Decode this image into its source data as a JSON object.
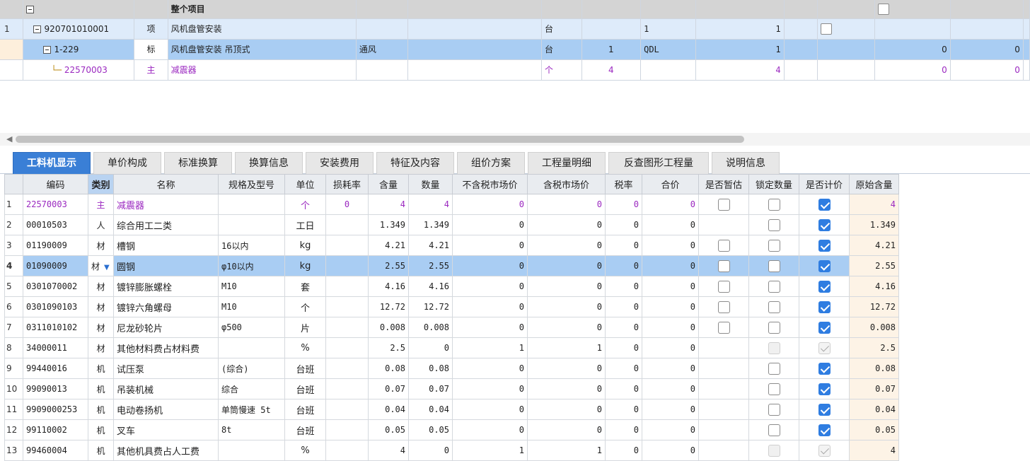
{
  "top_grid": {
    "header": {
      "title": "整个项目"
    },
    "rows": [
      {
        "no": "1",
        "code": "920701010001",
        "type": "项",
        "name": "风机盘管安装",
        "spec": "",
        "unit": "台",
        "qty1": "",
        "expr": "1",
        "qty": "1",
        "v1": "",
        "v2": ""
      },
      {
        "no": "",
        "code": "1-229",
        "type": "标",
        "name": "风机盘管安装 吊顶式",
        "spec": "通风",
        "unit": "台",
        "qty1": "1",
        "expr": "QDL",
        "qty": "1",
        "v1": "0",
        "v2": "0"
      },
      {
        "no": "",
        "code": "22570003",
        "type": "主",
        "name": "减震器",
        "spec": "",
        "unit": "个",
        "qty1": "4",
        "expr": "",
        "qty": "4",
        "v1": "0",
        "v2": "0"
      }
    ]
  },
  "tabs": [
    "工料机显示",
    "单价构成",
    "标准换算",
    "换算信息",
    "安装费用",
    "特征及内容",
    "组价方案",
    "工程量明细",
    "反查图形工程量",
    "说明信息"
  ],
  "active_tab": "工料机显示",
  "detail_grid": {
    "columns": [
      "",
      "编码",
      "类别",
      "名称",
      "规格及型号",
      "单位",
      "损耗率",
      "含量",
      "数量",
      "不含税市场价",
      "含税市场价",
      "税率",
      "合价",
      "是否暂估",
      "锁定数量",
      "是否计价",
      "原始含量"
    ],
    "rows": [
      {
        "idx": "1",
        "code": "22570003",
        "cat": "主",
        "name": "减震器",
        "spec": "",
        "unit": "个",
        "loss": "0",
        "content": "4",
        "qty": "4",
        "price_ex": "0",
        "price_in": "0",
        "tax": "0",
        "total": "0",
        "est": "off",
        "lock": "off",
        "priced": "on",
        "orig": "4"
      },
      {
        "idx": "2",
        "code": "00010503",
        "cat": "人",
        "name": "综合用工二类",
        "spec": "",
        "unit": "工日",
        "loss": "",
        "content": "1.349",
        "qty": "1.349",
        "price_ex": "0",
        "price_in": "0",
        "tax": "0",
        "total": "0",
        "est": "none",
        "lock": "off",
        "priced": "on",
        "orig": "1.349"
      },
      {
        "idx": "3",
        "code": "01190009",
        "cat": "材",
        "name": "槽钢",
        "spec": "16以内",
        "unit": "kg",
        "loss": "",
        "content": "4.21",
        "qty": "4.21",
        "price_ex": "0",
        "price_in": "0",
        "tax": "0",
        "total": "0",
        "est": "off",
        "lock": "off",
        "priced": "on",
        "orig": "4.21"
      },
      {
        "idx": "4",
        "code": "01090009",
        "cat": "材",
        "name": "圆钢",
        "spec": "φ10以内",
        "unit": "kg",
        "loss": "",
        "content": "2.55",
        "qty": "2.55",
        "price_ex": "0",
        "price_in": "0",
        "tax": "0",
        "total": "0",
        "est": "off",
        "lock": "off",
        "priced": "on",
        "orig": "2.55"
      },
      {
        "idx": "5",
        "code": "0301070002",
        "cat": "材",
        "name": "镀锌膨胀螺栓",
        "spec": "M10",
        "unit": "套",
        "loss": "",
        "content": "4.16",
        "qty": "4.16",
        "price_ex": "0",
        "price_in": "0",
        "tax": "0",
        "total": "0",
        "est": "off",
        "lock": "off",
        "priced": "on",
        "orig": "4.16"
      },
      {
        "idx": "6",
        "code": "0301090103",
        "cat": "材",
        "name": "镀锌六角螺母",
        "spec": "M10",
        "unit": "个",
        "loss": "",
        "content": "12.72",
        "qty": "12.72",
        "price_ex": "0",
        "price_in": "0",
        "tax": "0",
        "total": "0",
        "est": "off",
        "lock": "off",
        "priced": "on",
        "orig": "12.72"
      },
      {
        "idx": "7",
        "code": "0311010102",
        "cat": "材",
        "name": "尼龙砂轮片",
        "spec": "φ500",
        "unit": "片",
        "loss": "",
        "content": "0.008",
        "qty": "0.008",
        "price_ex": "0",
        "price_in": "0",
        "tax": "0",
        "total": "0",
        "est": "off",
        "lock": "off",
        "priced": "on",
        "orig": "0.008"
      },
      {
        "idx": "8",
        "code": "34000011",
        "cat": "材",
        "name": "其他材料费占材料费",
        "spec": "",
        "unit": "%",
        "loss": "",
        "content": "2.5",
        "qty": "0",
        "price_ex": "1",
        "price_in": "1",
        "tax": "0",
        "total": "0",
        "est": "none",
        "lock": "disabled",
        "priced": "disabled-on",
        "orig": "2.5"
      },
      {
        "idx": "9",
        "code": "99440016",
        "cat": "机",
        "name": "试压泵",
        "spec": "(综合)",
        "unit": "台班",
        "loss": "",
        "content": "0.08",
        "qty": "0.08",
        "price_ex": "0",
        "price_in": "0",
        "tax": "0",
        "total": "0",
        "est": "none",
        "lock": "off",
        "priced": "on",
        "orig": "0.08"
      },
      {
        "idx": "10",
        "code": "99090013",
        "cat": "机",
        "name": "吊装机械",
        "spec": "综合",
        "unit": "台班",
        "loss": "",
        "content": "0.07",
        "qty": "0.07",
        "price_ex": "0",
        "price_in": "0",
        "tax": "0",
        "total": "0",
        "est": "none",
        "lock": "off",
        "priced": "on",
        "orig": "0.07"
      },
      {
        "idx": "11",
        "code": "9909000253",
        "cat": "机",
        "name": "电动卷扬机",
        "spec": "单筒慢速 5t",
        "unit": "台班",
        "loss": "",
        "content": "0.04",
        "qty": "0.04",
        "price_ex": "0",
        "price_in": "0",
        "tax": "0",
        "total": "0",
        "est": "none",
        "lock": "off",
        "priced": "on",
        "orig": "0.04"
      },
      {
        "idx": "12",
        "code": "99110002",
        "cat": "机",
        "name": "叉车",
        "spec": "8t",
        "unit": "台班",
        "loss": "",
        "content": "0.05",
        "qty": "0.05",
        "price_ex": "0",
        "price_in": "0",
        "tax": "0",
        "total": "0",
        "est": "none",
        "lock": "off",
        "priced": "on",
        "orig": "0.05"
      },
      {
        "idx": "13",
        "code": "99460004",
        "cat": "机",
        "name": "其他机具费占人工费",
        "spec": "",
        "unit": "%",
        "loss": "",
        "content": "4",
        "qty": "0",
        "price_ex": "1",
        "price_in": "1",
        "tax": "0",
        "total": "0",
        "est": "none",
        "lock": "disabled",
        "priced": "disabled-on",
        "orig": "4"
      }
    ]
  }
}
